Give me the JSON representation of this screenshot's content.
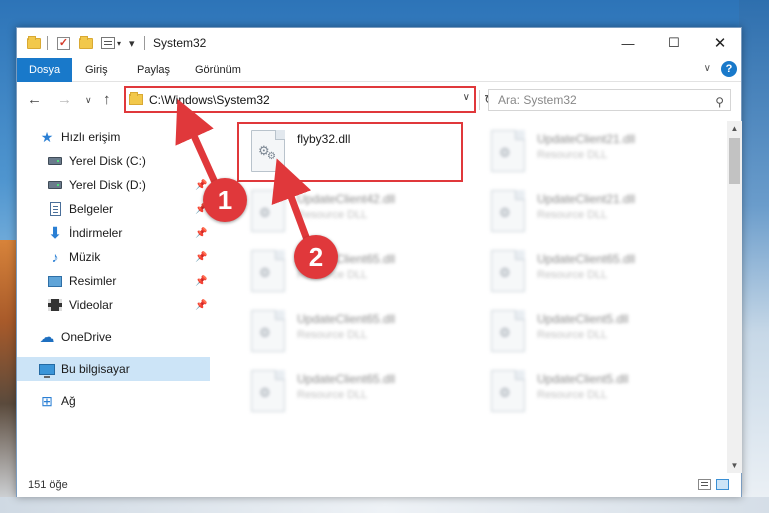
{
  "window": {
    "title": "System32"
  },
  "ribbon": {
    "tabs": [
      {
        "label": "Dosya",
        "active": true
      },
      {
        "label": "Giriş"
      },
      {
        "label": "Paylaş"
      },
      {
        "label": "Görünüm"
      }
    ],
    "help": "?"
  },
  "nav": {
    "address": "C:\\Windows\\System32",
    "search_placeholder": "Ara: System32"
  },
  "sidebar": {
    "items": [
      {
        "label": "Hızlı erişim",
        "icon": "star-icon"
      },
      {
        "label": "Yerel Disk (C:)",
        "icon": "drive-icon",
        "pinned": true
      },
      {
        "label": "Yerel Disk (D:)",
        "icon": "drive-icon",
        "pinned": true
      },
      {
        "label": "Belgeler",
        "icon": "documents-icon",
        "pinned": true
      },
      {
        "label": "İndirmeler",
        "icon": "download-icon",
        "pinned": true
      },
      {
        "label": "Müzik",
        "icon": "music-icon",
        "pinned": true
      },
      {
        "label": "Resimler",
        "icon": "pictures-icon",
        "pinned": true
      },
      {
        "label": "Videolar",
        "icon": "videos-icon",
        "pinned": true
      },
      {
        "label": "OneDrive",
        "icon": "cloud-icon"
      },
      {
        "label": "Bu bilgisayar",
        "icon": "computer-icon",
        "selected": true
      },
      {
        "label": "Ağ",
        "icon": "network-icon"
      }
    ]
  },
  "files": {
    "items": [
      {
        "name": "flyby32.dll",
        "type": ""
      },
      {
        "name": "UpdateClient21.dll",
        "type": "Resource DLL"
      },
      {
        "name": "UpdateClient42.dll",
        "type": "Resource DLL"
      },
      {
        "name": "UpdateClient21.dll",
        "type": "Resource DLL"
      },
      {
        "name": "UpdateClient65.dll",
        "type": "Resource DLL"
      },
      {
        "name": "UpdateClient65.dll",
        "type": "Resource DLL"
      },
      {
        "name": "UpdateClient65.dll",
        "type": "Resource DLL"
      },
      {
        "name": "UpdateClient5.dll",
        "type": "Resource DLL"
      },
      {
        "name": "UpdateClient65.dll",
        "type": "Resource DLL"
      },
      {
        "name": "UpdateClient5.dll",
        "type": "Resource DLL"
      }
    ]
  },
  "status": {
    "item_count": "151 öğe"
  },
  "annotations": {
    "step1": "1",
    "step2": "2",
    "color": "#e0383b"
  }
}
